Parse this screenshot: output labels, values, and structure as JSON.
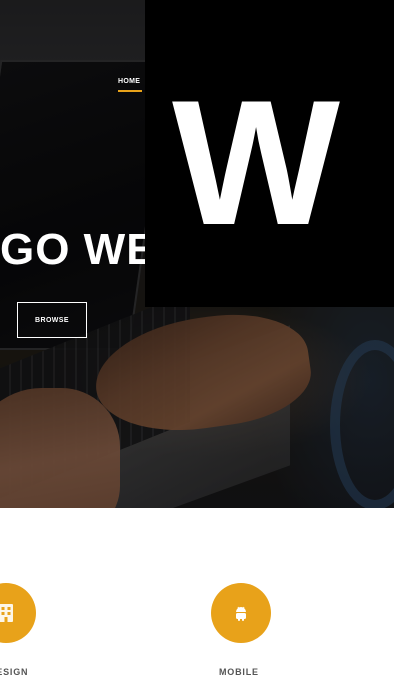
{
  "navigation": {
    "home_label": "HOME"
  },
  "hero": {
    "title": "GO WE",
    "browse_label": "BROWSE"
  },
  "overlay": {
    "text": "W"
  },
  "services": [
    {
      "label": "DESIGN",
      "icon": "building-icon"
    },
    {
      "label": "MOBILE",
      "icon": "android-icon"
    }
  ],
  "colors": {
    "accent": "#e8a21a",
    "overlay": "#000000",
    "text_light": "#ffffff",
    "label_text": "#555555"
  }
}
